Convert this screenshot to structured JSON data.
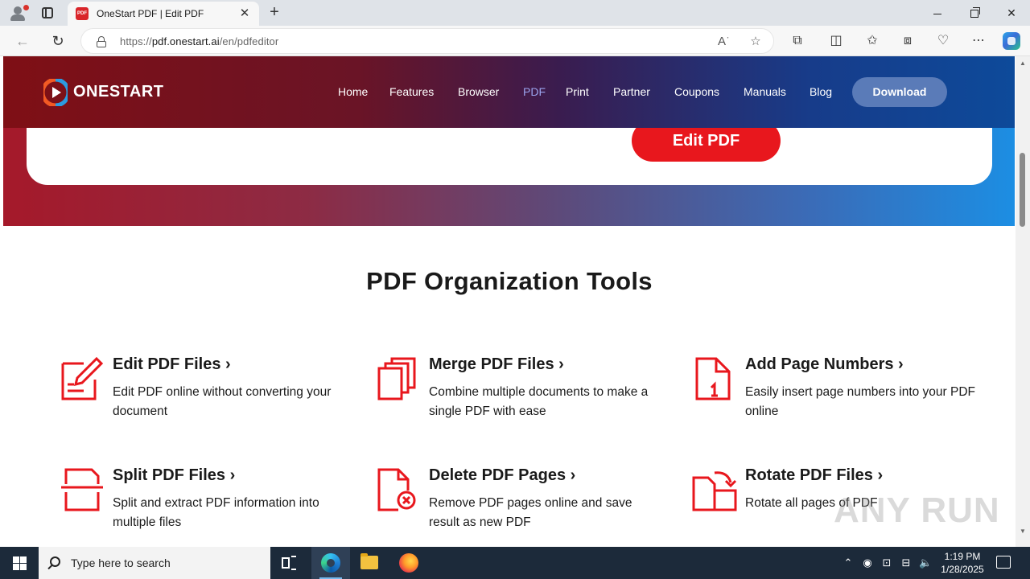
{
  "browser": {
    "tab_title": "OneStart PDF | Edit PDF",
    "tab_favicon_text": "PDF",
    "url_prefix": "https://",
    "url_domain": "pdf.onestart.ai",
    "url_path": "/en/pdfeditor"
  },
  "site": {
    "logo_text": "ONESTART",
    "nav": [
      "Home",
      "Features",
      "Browser",
      "PDF",
      "Print",
      "Partner",
      "Coupons",
      "Manuals",
      "Blog"
    ],
    "active_nav": "PDF",
    "download_label": "Download",
    "hero_button": "Edit PDF",
    "section_title": "PDF Organization Tools",
    "tools": [
      {
        "title": "Edit PDF Files ›",
        "desc": "Edit PDF online without converting your document",
        "icon": "edit-pdf-icon"
      },
      {
        "title": "Merge PDF Files ›",
        "desc": "Combine multiple documents to make a single PDF with ease",
        "icon": "merge-pdf-icon"
      },
      {
        "title": "Add Page Numbers ›",
        "desc": "Easily insert page numbers into your PDF online",
        "icon": "page-numbers-icon"
      },
      {
        "title": "Split PDF Files ›",
        "desc": "Split and extract PDF information into multiple files",
        "icon": "split-pdf-icon"
      },
      {
        "title": "Delete PDF Pages ›",
        "desc": "Remove PDF pages online and save result as new PDF",
        "icon": "delete-pages-icon"
      },
      {
        "title": "Rotate PDF Files ›",
        "desc": "Rotate all pages of PDF",
        "icon": "rotate-pdf-icon"
      }
    ],
    "colors": {
      "accent_red": "#e8171d",
      "download_bg": "#5a7bb8",
      "active_nav": "#9ba4ee"
    }
  },
  "watermark": "ANY RUN",
  "taskbar": {
    "search_placeholder": "Type here to search",
    "time": "1:19 PM",
    "date": "1/28/2025"
  }
}
